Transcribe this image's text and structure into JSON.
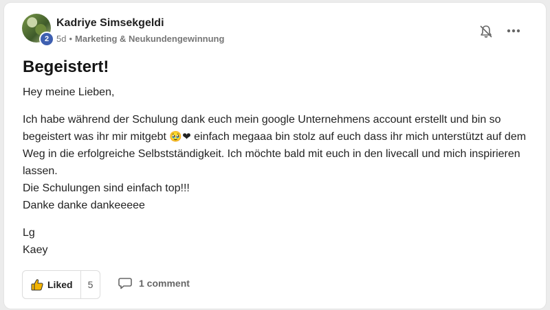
{
  "post": {
    "author": "Kadriye Simsekgeldi",
    "level": "2",
    "age": "5d",
    "separator": "•",
    "category": "Marketing & Neukundengewinnung",
    "title": "Begeistert!",
    "greeting": "Hey meine Lieben,",
    "paragraph_part1": "Ich habe während der Schulung dank euch mein google Unternehmens account erstellt und bin so begeistert was ihr mir mitgebt",
    "emojis": "🥹❤",
    "paragraph_part2": " einfach megaaa bin stolz auf euch dass ihr mich unterstützt auf dem Weg in die erfolgreiche Selbstständigkeit. Ich möchte bald mit euch in den livecall und mich inspirieren lassen.",
    "line_top": "Die Schulungen sind einfach top!!!",
    "line_thanks": "Danke danke dankeeeee",
    "signoff_lg": "Lg",
    "signoff_name": "Kaey"
  },
  "actions": {
    "like_label": "Liked",
    "like_count": "5",
    "comment_label": "1 comment"
  },
  "icons": {
    "bell": "bell-off-icon",
    "more": "more-horizontal-icon",
    "thumb": "thumbs-up-icon",
    "comment": "comment-icon"
  },
  "colors": {
    "badge": "#3e5fb0",
    "thumb": "#f4b400"
  }
}
